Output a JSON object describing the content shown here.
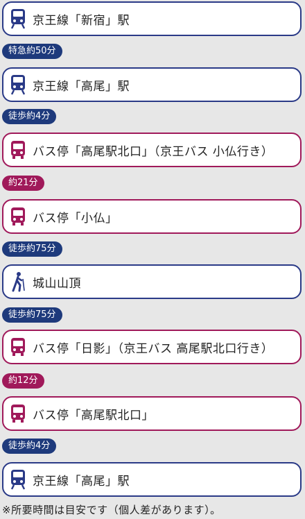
{
  "colors": {
    "train": "#2a3a87",
    "bus": "#a0195a",
    "walk_badge": "#1e3a7c",
    "bus_badge": "#a0195a"
  },
  "steps": [
    {
      "type": "stop",
      "kind": "train",
      "icon": "train-icon",
      "name": "京王線「新宿」駅"
    },
    {
      "type": "conn",
      "color": "blue",
      "label": "特急約50分"
    },
    {
      "type": "stop",
      "kind": "train",
      "icon": "train-icon",
      "name": "京王線「高尾」駅"
    },
    {
      "type": "conn",
      "color": "blue",
      "label": "徒歩約4分"
    },
    {
      "type": "stop",
      "kind": "bus",
      "icon": "bus-icon",
      "name": "バス停「高尾駅北口」（京王バス 小仏行き）"
    },
    {
      "type": "conn",
      "color": "mag",
      "label": "約21分"
    },
    {
      "type": "stop",
      "kind": "bus",
      "icon": "bus-icon",
      "name": "バス停「小仏」"
    },
    {
      "type": "conn",
      "color": "blue",
      "label": "徒歩約75分"
    },
    {
      "type": "stop",
      "kind": "walk",
      "icon": "hiker-icon",
      "name": "城山山頂"
    },
    {
      "type": "conn",
      "color": "blue",
      "label": "徒歩約75分"
    },
    {
      "type": "stop",
      "kind": "bus",
      "icon": "bus-icon",
      "name": "バス停「日影」（京王バス 高尾駅北口行き）"
    },
    {
      "type": "conn",
      "color": "mag",
      "label": "約12分"
    },
    {
      "type": "stop",
      "kind": "bus",
      "icon": "bus-icon",
      "name": "バス停「高尾駅北口」"
    },
    {
      "type": "conn",
      "color": "blue",
      "label": "徒歩約4分"
    },
    {
      "type": "stop",
      "kind": "train",
      "icon": "train-icon",
      "name": "京王線「高尾」駅"
    }
  ],
  "note": "※所要時間は目安です（個人差があります）。"
}
